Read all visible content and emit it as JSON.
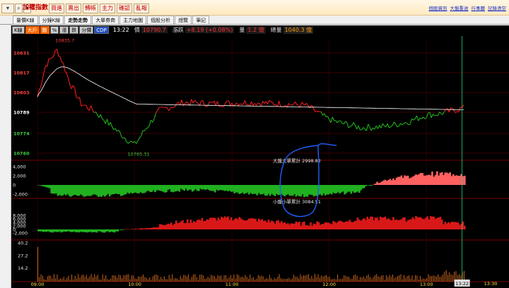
{
  "top": {
    "title": "加權指數",
    "buttons": [
      "買進",
      "賣出",
      "轉帳",
      "主力",
      "確認",
      "亂報"
    ],
    "links": [
      "個股資訊",
      "大盤重送",
      "行事曆",
      "記錄清空"
    ]
  },
  "tabs": [
    "量價K線",
    "分鐘K線",
    "走勢走勢",
    "大單券商",
    "主力地圖",
    "個股分析",
    "總覽",
    "筆記"
  ],
  "active_tab": 2,
  "infobar": {
    "buttons": [
      "K線",
      "大戶",
      "散",
      "%",
      "漲",
      "跌",
      "分價",
      "CDP"
    ],
    "time": "13:22",
    "price_label": "價",
    "price": "10790.7",
    "change_label": "漲跌",
    "change": "+8.19 (+0.08%)",
    "volume_label": "量",
    "volume": "1.2 億",
    "total_label": "總量",
    "total": "1040.3 億"
  },
  "chart_data": {
    "type": "line",
    "price_axis": [
      "10831",
      "10817",
      "10803",
      "10789",
      "10774",
      "10760"
    ],
    "high_label": "10835.7",
    "low_label": "10765.31",
    "big_label": "大盤大單累計 2998.82",
    "small_label": "小盤小單累計 3084.51",
    "big_axis": [
      "4,000",
      "2,000",
      "0",
      "-2,000"
    ],
    "small_axis": [
      "8,000",
      "6,000",
      "4,000",
      "2,000",
      "0",
      "-2,000"
    ],
    "vol_axis": [
      "40.2",
      "27.2",
      "14.2"
    ],
    "time_axis": [
      "09:00",
      "10:00",
      "11:00",
      "12:00",
      "13:00"
    ],
    "cursor_time": "13:22",
    "end_time": "13:30",
    "ylim": [
      10755,
      10840
    ],
    "colors": {
      "up": "#ff2020",
      "down": "#22c022",
      "avg": "#ffffff",
      "grid": "#7a0000",
      "volume": "#e07020",
      "blueline": "#2060ff"
    }
  }
}
